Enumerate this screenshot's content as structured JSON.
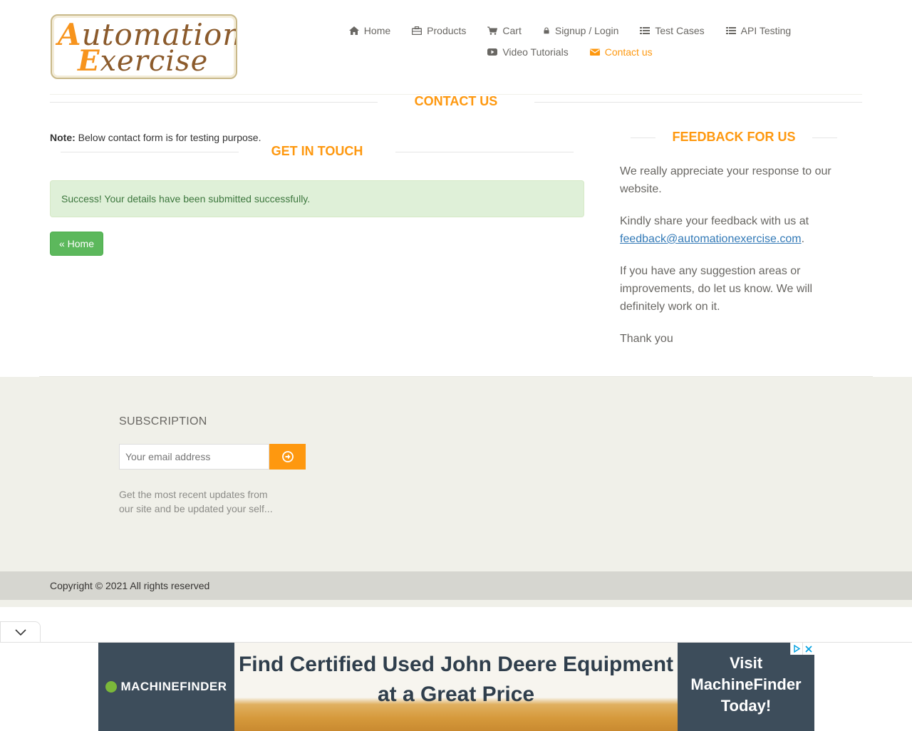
{
  "logo": {
    "line1_cap": "A",
    "line1_rest": "utomation",
    "line2_cap": "E",
    "line2_rest": "xercise"
  },
  "nav": {
    "items": [
      {
        "label": "Home",
        "icon": "home-icon"
      },
      {
        "label": "Products",
        "icon": "briefcase-icon"
      },
      {
        "label": "Cart",
        "icon": "cart-icon"
      },
      {
        "label": "Signup / Login",
        "icon": "lock-icon"
      },
      {
        "label": "Test Cases",
        "icon": "list-icon"
      },
      {
        "label": "API Testing",
        "icon": "list-icon"
      },
      {
        "label": "Video Tutorials",
        "icon": "youtube-play-icon"
      },
      {
        "label": "Contact us",
        "icon": "envelope-icon",
        "active": true
      }
    ]
  },
  "page_title": "CONTACT US",
  "note": {
    "label": "Note:",
    "text": " Below contact form is for testing purpose."
  },
  "get_in_touch": "GET IN TOUCH",
  "alert": "Success! Your details have been submitted successfully.",
  "home_button": "« Home",
  "feedback": {
    "title": "FEEDBACK FOR US",
    "p1": "We really appreciate your response to our website.",
    "p2_pre": "Kindly share your feedback with us at ",
    "p2_link": "feedback@automationexercise.com",
    "p2_post": ".",
    "p3": "If you have any suggestion areas or improvements, do let us know. We will definitely work on it.",
    "p4": "Thank you"
  },
  "subscription": {
    "title": "SUBSCRIPTION",
    "placeholder": "Your email address",
    "description": "Get the most recent updates from our site and be updated your self..."
  },
  "copyright": "Copyright © 2021 All rights reserved",
  "ad": {
    "brand": "MACHINEFINDER",
    "headline": "Find Certified Used John Deere Equipment at a Great Price",
    "cta": "Visit MachineFinder Today!"
  },
  "colors": {
    "accent": "#fe980f",
    "success_bg": "#dff0d8",
    "success_text": "#3c763d",
    "button_green": "#5cb85c",
    "footer_bg": "#f0f0e9"
  }
}
